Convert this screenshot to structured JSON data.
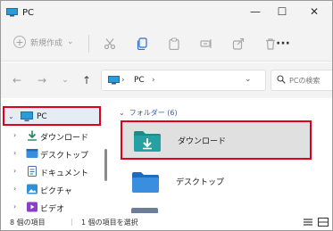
{
  "window": {
    "title": "PC"
  },
  "window_buttons": {
    "minimize": "—",
    "maximize": "☐",
    "close": "✕"
  },
  "toolbar": {
    "new_label": "新規作成",
    "new_chevron": "⌄",
    "more_label": "···"
  },
  "address": {
    "crumb": "PC",
    "separator": "›",
    "chevron": "⌄",
    "refresh": "⟳"
  },
  "search": {
    "placeholder": "PCの検索"
  },
  "nav": {
    "items": [
      {
        "label": "PC",
        "icon": "pc-icon",
        "expanded": true,
        "selected": true
      },
      {
        "label": "ダウンロード",
        "icon": "download-icon"
      },
      {
        "label": "デスクトップ",
        "icon": "desktop-folder-icon"
      },
      {
        "label": "ドキュメント",
        "icon": "documents-icon"
      },
      {
        "label": "ピクチャ",
        "icon": "pictures-icon"
      },
      {
        "label": "ビデオ",
        "icon": "videos-icon"
      }
    ]
  },
  "content": {
    "group_label": "フォルダー (6)",
    "folders": [
      {
        "name": "ダウンロード",
        "icon": "download-folder-icon",
        "selected": true
      },
      {
        "name": "デスクトップ",
        "icon": "desktop-folder-icon"
      }
    ]
  },
  "status": {
    "item_count": "8 個の項目",
    "selected_count": "1 個の項目を選択"
  },
  "colors": {
    "highlight_border": "#e0001b",
    "folder_teal": "#1f8a8a",
    "folder_blue": "#2f7fd1",
    "accent_blue": "#3b5ea8"
  }
}
